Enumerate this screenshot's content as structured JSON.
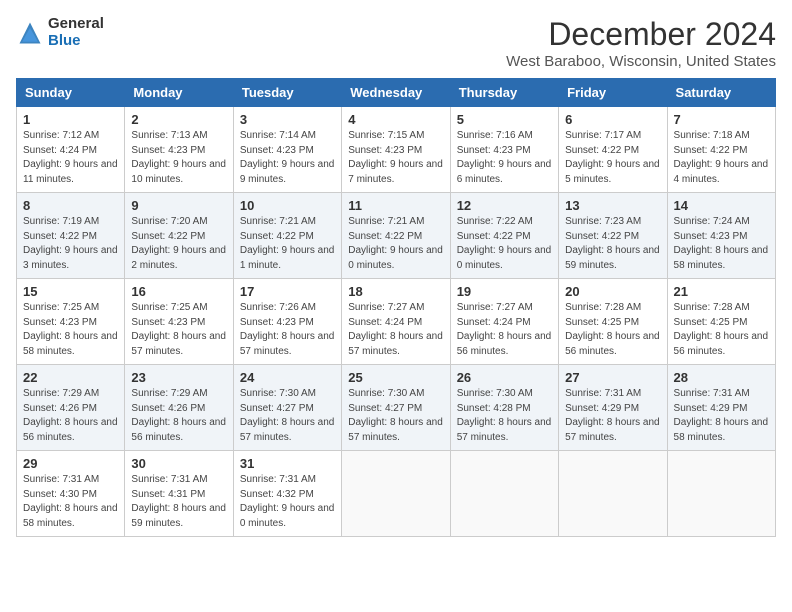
{
  "header": {
    "logo_general": "General",
    "logo_blue": "Blue",
    "month_title": "December 2024",
    "location": "West Baraboo, Wisconsin, United States"
  },
  "days_of_week": [
    "Sunday",
    "Monday",
    "Tuesday",
    "Wednesday",
    "Thursday",
    "Friday",
    "Saturday"
  ],
  "weeks": [
    [
      {
        "day": "1",
        "sunrise": "7:12 AM",
        "sunset": "4:24 PM",
        "daylight": "9 hours and 11 minutes."
      },
      {
        "day": "2",
        "sunrise": "7:13 AM",
        "sunset": "4:23 PM",
        "daylight": "9 hours and 10 minutes."
      },
      {
        "day": "3",
        "sunrise": "7:14 AM",
        "sunset": "4:23 PM",
        "daylight": "9 hours and 9 minutes."
      },
      {
        "day": "4",
        "sunrise": "7:15 AM",
        "sunset": "4:23 PM",
        "daylight": "9 hours and 7 minutes."
      },
      {
        "day": "5",
        "sunrise": "7:16 AM",
        "sunset": "4:23 PM",
        "daylight": "9 hours and 6 minutes."
      },
      {
        "day": "6",
        "sunrise": "7:17 AM",
        "sunset": "4:22 PM",
        "daylight": "9 hours and 5 minutes."
      },
      {
        "day": "7",
        "sunrise": "7:18 AM",
        "sunset": "4:22 PM",
        "daylight": "9 hours and 4 minutes."
      }
    ],
    [
      {
        "day": "8",
        "sunrise": "7:19 AM",
        "sunset": "4:22 PM",
        "daylight": "9 hours and 3 minutes."
      },
      {
        "day": "9",
        "sunrise": "7:20 AM",
        "sunset": "4:22 PM",
        "daylight": "9 hours and 2 minutes."
      },
      {
        "day": "10",
        "sunrise": "7:21 AM",
        "sunset": "4:22 PM",
        "daylight": "9 hours and 1 minute."
      },
      {
        "day": "11",
        "sunrise": "7:21 AM",
        "sunset": "4:22 PM",
        "daylight": "9 hours and 0 minutes."
      },
      {
        "day": "12",
        "sunrise": "7:22 AM",
        "sunset": "4:22 PM",
        "daylight": "9 hours and 0 minutes."
      },
      {
        "day": "13",
        "sunrise": "7:23 AM",
        "sunset": "4:22 PM",
        "daylight": "8 hours and 59 minutes."
      },
      {
        "day": "14",
        "sunrise": "7:24 AM",
        "sunset": "4:23 PM",
        "daylight": "8 hours and 58 minutes."
      }
    ],
    [
      {
        "day": "15",
        "sunrise": "7:25 AM",
        "sunset": "4:23 PM",
        "daylight": "8 hours and 58 minutes."
      },
      {
        "day": "16",
        "sunrise": "7:25 AM",
        "sunset": "4:23 PM",
        "daylight": "8 hours and 57 minutes."
      },
      {
        "day": "17",
        "sunrise": "7:26 AM",
        "sunset": "4:23 PM",
        "daylight": "8 hours and 57 minutes."
      },
      {
        "day": "18",
        "sunrise": "7:27 AM",
        "sunset": "4:24 PM",
        "daylight": "8 hours and 57 minutes."
      },
      {
        "day": "19",
        "sunrise": "7:27 AM",
        "sunset": "4:24 PM",
        "daylight": "8 hours and 56 minutes."
      },
      {
        "day": "20",
        "sunrise": "7:28 AM",
        "sunset": "4:25 PM",
        "daylight": "8 hours and 56 minutes."
      },
      {
        "day": "21",
        "sunrise": "7:28 AM",
        "sunset": "4:25 PM",
        "daylight": "8 hours and 56 minutes."
      }
    ],
    [
      {
        "day": "22",
        "sunrise": "7:29 AM",
        "sunset": "4:26 PM",
        "daylight": "8 hours and 56 minutes."
      },
      {
        "day": "23",
        "sunrise": "7:29 AM",
        "sunset": "4:26 PM",
        "daylight": "8 hours and 56 minutes."
      },
      {
        "day": "24",
        "sunrise": "7:30 AM",
        "sunset": "4:27 PM",
        "daylight": "8 hours and 57 minutes."
      },
      {
        "day": "25",
        "sunrise": "7:30 AM",
        "sunset": "4:27 PM",
        "daylight": "8 hours and 57 minutes."
      },
      {
        "day": "26",
        "sunrise": "7:30 AM",
        "sunset": "4:28 PM",
        "daylight": "8 hours and 57 minutes."
      },
      {
        "day": "27",
        "sunrise": "7:31 AM",
        "sunset": "4:29 PM",
        "daylight": "8 hours and 57 minutes."
      },
      {
        "day": "28",
        "sunrise": "7:31 AM",
        "sunset": "4:29 PM",
        "daylight": "8 hours and 58 minutes."
      }
    ],
    [
      {
        "day": "29",
        "sunrise": "7:31 AM",
        "sunset": "4:30 PM",
        "daylight": "8 hours and 58 minutes."
      },
      {
        "day": "30",
        "sunrise": "7:31 AM",
        "sunset": "4:31 PM",
        "daylight": "8 hours and 59 minutes."
      },
      {
        "day": "31",
        "sunrise": "7:31 AM",
        "sunset": "4:32 PM",
        "daylight": "9 hours and 0 minutes."
      },
      null,
      null,
      null,
      null
    ]
  ]
}
